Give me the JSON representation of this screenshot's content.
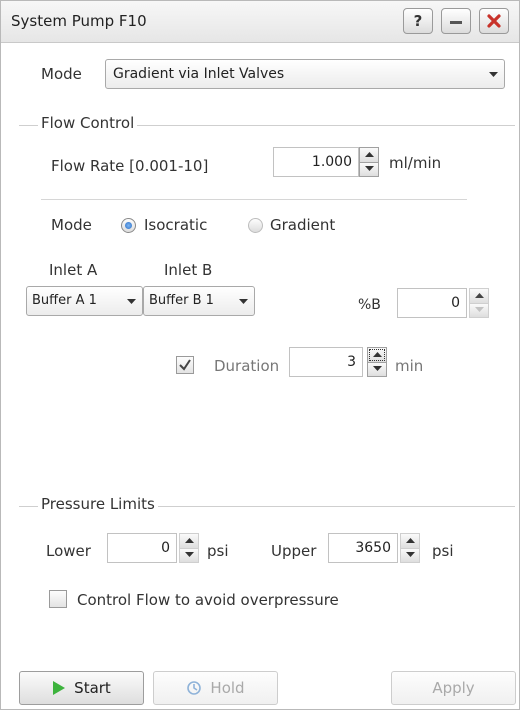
{
  "window": {
    "title": "System Pump F10",
    "help_label": "?",
    "minimize_icon": "minimize-icon",
    "close_icon": "close-icon"
  },
  "mode_row": {
    "label": "Mode",
    "selected": "Gradient via Inlet Valves"
  },
  "flow_control": {
    "group_title": "Flow Control",
    "flow_rate_label": "Flow Rate [0.001-10]",
    "flow_rate_value": "1.000",
    "flow_rate_unit": "ml/min",
    "mode_label": "Mode",
    "mode_options": [
      {
        "label": "Isocratic",
        "selected": true
      },
      {
        "label": "Gradient",
        "selected": false
      }
    ],
    "inlet_a_label": "Inlet A",
    "inlet_b_label": "Inlet B",
    "inlet_a_value": "Buffer A 1",
    "inlet_b_value": "Buffer B 1",
    "percent_b_label": "%B",
    "percent_b_value": "0",
    "duration_checked": true,
    "duration_label": "Duration",
    "duration_value": "3",
    "duration_unit": "min"
  },
  "pressure_limits": {
    "group_title": "Pressure Limits",
    "lower_label": "Lower",
    "lower_value": "0",
    "lower_unit": "psi",
    "upper_label": "Upper",
    "upper_value": "3650",
    "upper_unit": "psi",
    "control_flow_label": "Control Flow to avoid overpressure",
    "control_flow_checked": false
  },
  "footer": {
    "start_label": "Start",
    "hold_label": "Hold",
    "apply_label": "Apply"
  },
  "colors": {
    "accent": "#2a6ec7",
    "start_icon": "#3db33d",
    "close_button": "#c8322a"
  }
}
